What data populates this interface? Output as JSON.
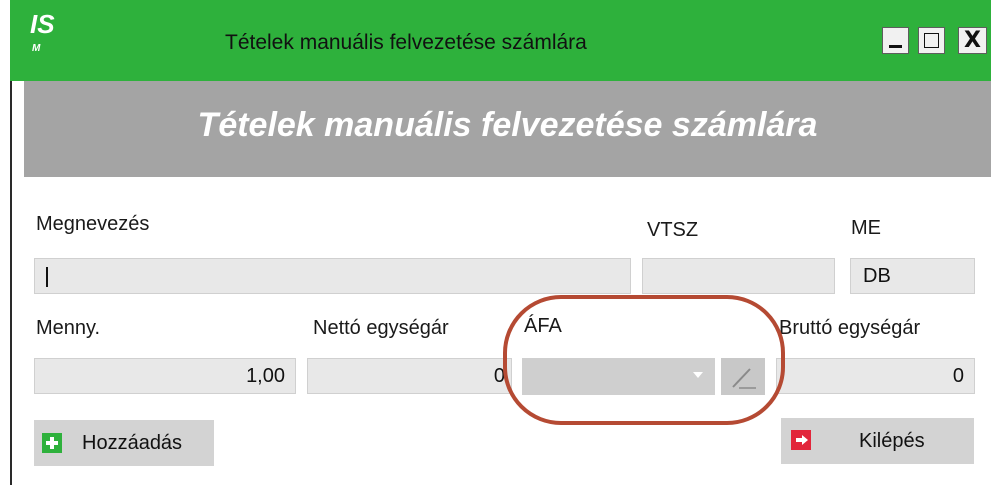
{
  "window": {
    "title": "Tételek manuális felvezetése számlára",
    "logo": "IS M",
    "controls": {
      "minimize": "_",
      "maximize": "□",
      "close": "X"
    }
  },
  "header": {
    "title": "Tételek manuális felvezetése számlára"
  },
  "form": {
    "megnevezes_label": "Megnevezés",
    "megnevezes_value": "",
    "vtsz_label": "VTSZ",
    "vtsz_value": "",
    "me_label": "ME",
    "me_value": "DB",
    "menny_label": "Menny.",
    "menny_value": "1,00",
    "netto_label": "Nettó egységár",
    "netto_value": "0",
    "afa_label": "ÁFA",
    "afa_value": "",
    "brutto_label": "Bruttó egységár",
    "brutto_value": "0"
  },
  "buttons": {
    "add_label": "Hozzáadás",
    "exit_label": "Kilépés"
  },
  "colors": {
    "titlebar": "#2eb13c",
    "header_band": "#a4a4a4",
    "annotation": "#b54a33",
    "exit_icon": "#e2253a"
  },
  "icons": {
    "logo": "app-logo-icon",
    "add": "plus-icon",
    "exit": "exit-icon",
    "edit": "pencil-icon",
    "dropdown": "chevron-down-icon"
  }
}
